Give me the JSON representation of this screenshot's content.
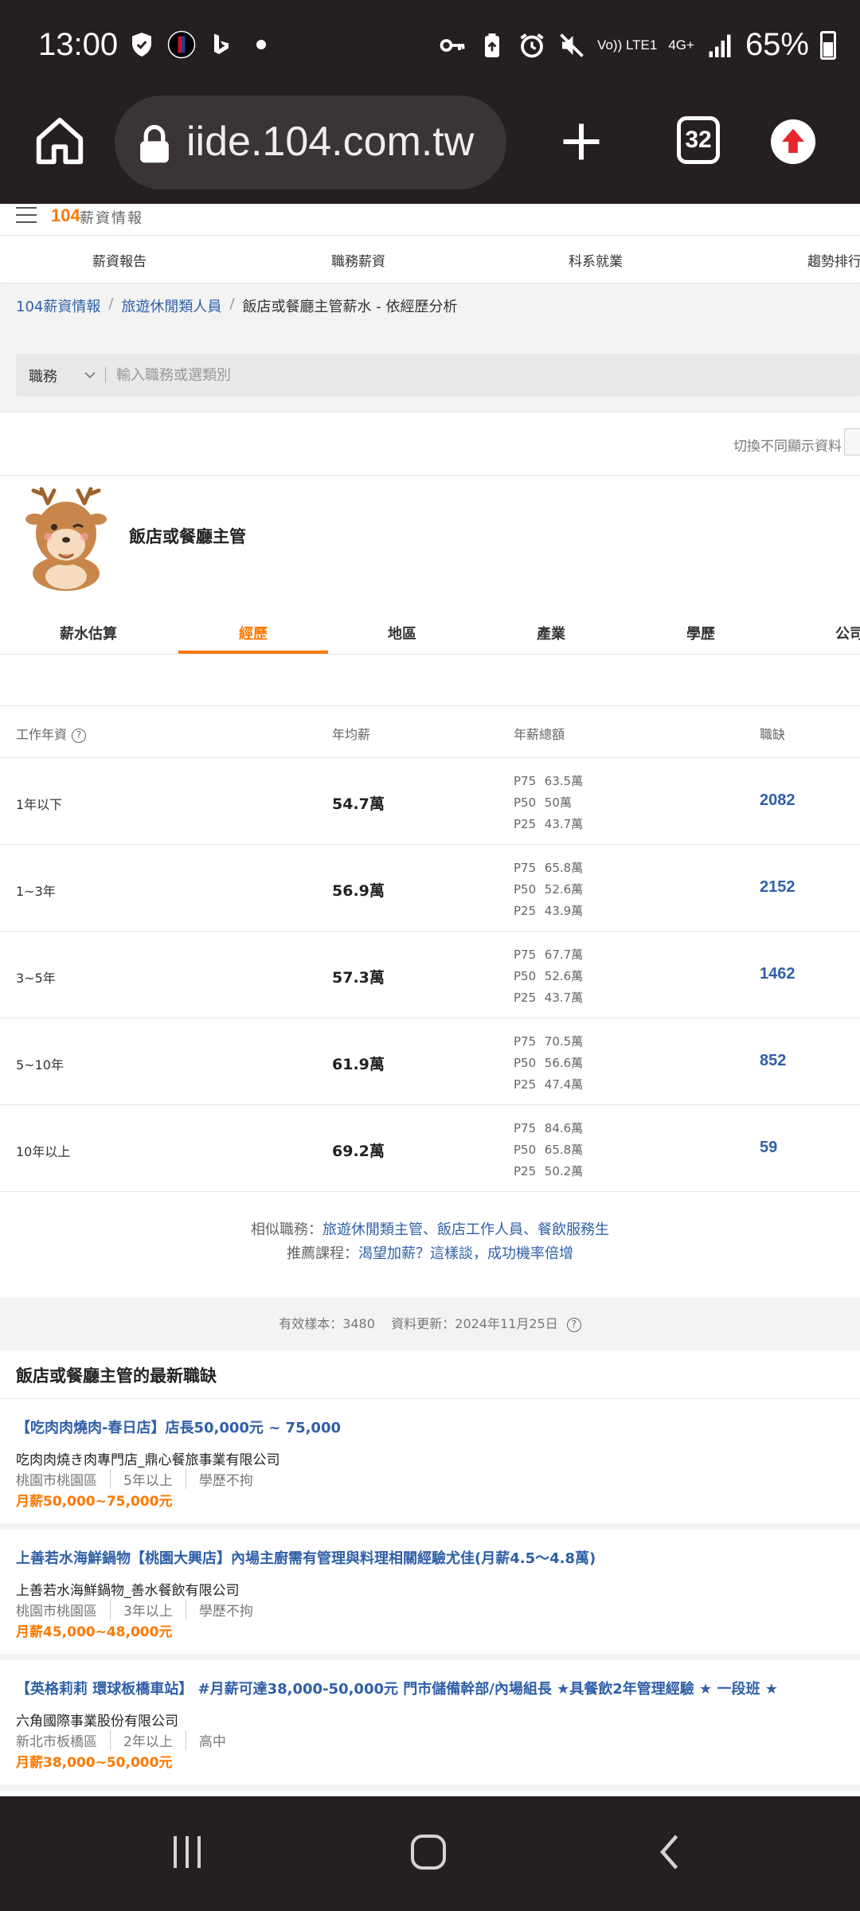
{
  "status_bar": {
    "time": "13:00",
    "network_top": "Vo)) LTE1",
    "network_4g": "4G+",
    "battery": "65%"
  },
  "browser": {
    "url": "iide.104.com.tw",
    "tab_count": "32"
  },
  "site": {
    "logo_num": "104",
    "logo_text": "薪資情報",
    "nav": [
      "薪資報告",
      "職務薪資",
      "科系就業",
      "趨勢排行"
    ]
  },
  "breadcrumb": {
    "items": [
      "104薪資情報",
      "旅遊休閒類人員",
      "飯店或餐廳主管薪水 - 依經歷分析"
    ],
    "sep": "/"
  },
  "search": {
    "select_label": "職務",
    "placeholder": "輸入職務或選類別"
  },
  "toggle_label": "切換不同顯示資料",
  "job_title": "飯店或餐廳主管",
  "tabs": [
    "薪水估算",
    "經歷",
    "地區",
    "產業",
    "學歷",
    "公司"
  ],
  "active_tab": "經歷",
  "table": {
    "headers": [
      "工作年資",
      "年均薪",
      "年薪總額",
      "職缺"
    ],
    "help_glyph": "?",
    "rows": [
      {
        "exp": "1年以下",
        "avg": "54.7萬",
        "p75": "63.5萬",
        "p50": "50萬",
        "p25": "43.7萬",
        "jobs": "2082"
      },
      {
        "exp": "1~3年",
        "avg": "56.9萬",
        "p75": "65.8萬",
        "p50": "52.6萬",
        "p25": "43.9萬",
        "jobs": "2152"
      },
      {
        "exp": "3~5年",
        "avg": "57.3萬",
        "p75": "67.7萬",
        "p50": "52.6萬",
        "p25": "43.7萬",
        "jobs": "1462"
      },
      {
        "exp": "5~10年",
        "avg": "61.9萬",
        "p75": "70.5萬",
        "p50": "56.6萬",
        "p25": "47.4萬",
        "jobs": "852"
      },
      {
        "exp": "10年以上",
        "avg": "69.2萬",
        "p75": "84.6萬",
        "p50": "65.8萬",
        "p25": "50.2萬",
        "jobs": "59"
      }
    ],
    "p_labels": [
      "P75",
      "P50",
      "P25"
    ]
  },
  "related": {
    "similar_label": "相似職務：",
    "similar_links": "旅遊休閒類主管、飯店工作人員、餐飲服務生",
    "course_label": "推薦課程：",
    "course_link": "渴望加薪？這樣談，成功機率倍增"
  },
  "meta": {
    "sample": "有效樣本：3480",
    "updated": "資料更新：2024年11月25日"
  },
  "latest": {
    "title": "飯店或餐廳主管的最新職缺",
    "jobs": [
      {
        "title": "【吃肉肉燒肉-春日店】店長50,000元 ~ 75,000",
        "company": "吃肉肉燒き肉專門店_鼎心餐旅事業有限公司",
        "location": "桃園市桃園區",
        "exp": "5年以上",
        "edu": "學歷不拘",
        "pay": "月薪50,000~75,000元"
      },
      {
        "title": "上善若水海鮮鍋物【桃園大興店】內場主廚需有管理與料理相關經驗尤佳(月薪4.5〜4.8萬)",
        "company": "上善若水海鮮鍋物_善水餐飲有限公司",
        "location": "桃園市桃園區",
        "exp": "3年以上",
        "edu": "學歷不拘",
        "pay": "月薪45,000~48,000元"
      },
      {
        "title": "【英格莉莉 環球板橋車站】 #月薪可達38,000-50,000元 門市儲備幹部/內場組長 ★具餐飲2年管理經驗 ★ 一段班 ★",
        "company": "六角國際事業股份有限公司",
        "location": "新北市板橋區",
        "exp": "2年以上",
        "edu": "高中",
        "pay": "月薪38,000~50,000元"
      }
    ]
  },
  "colors": {
    "accent": "#ff7800",
    "link": "#2f5fa8",
    "system_bar": "#251f1f"
  }
}
